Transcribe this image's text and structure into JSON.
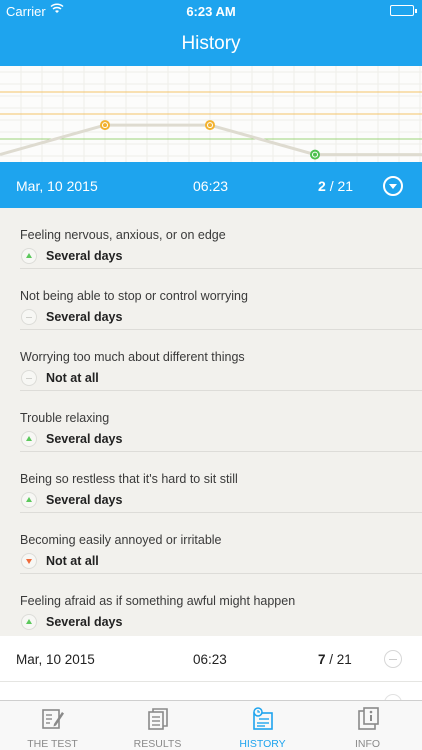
{
  "status_bar": {
    "carrier": "Carrier",
    "time": "6:23 AM"
  },
  "nav": {
    "title": "History"
  },
  "chart_data": {
    "type": "line",
    "x": [
      0,
      1,
      2,
      3,
      4
    ],
    "series": [
      {
        "values": [
          0,
          2,
          2,
          0,
          0
        ]
      }
    ],
    "threshold_lines": [
      {
        "color": "#f4c36a"
      },
      {
        "color": "#f4c36a"
      },
      {
        "color": "#9bd47a"
      }
    ],
    "ylim": [
      -0.5,
      6
    ],
    "grid": true
  },
  "selected_entry": {
    "date": "Mar, 10 2015",
    "time": "06:23",
    "score": "2",
    "max": "/ 21"
  },
  "questions": [
    {
      "text": "Feeling nervous, anxious, or on edge",
      "answer": "Several days",
      "trend": "up"
    },
    {
      "text": "Not being able to stop or control worrying",
      "answer": "Several days",
      "trend": "same"
    },
    {
      "text": "Worrying too much about different things",
      "answer": "Not at all",
      "trend": "same"
    },
    {
      "text": "Trouble relaxing",
      "answer": "Several days",
      "trend": "up"
    },
    {
      "text": "Being so restless that it's hard to sit still",
      "answer": "Several days",
      "trend": "up"
    },
    {
      "text": "Becoming easily annoyed or irritable",
      "answer": "Not at all",
      "trend": "down"
    },
    {
      "text": "Feeling afraid as if something awful might happen",
      "answer": "Several days",
      "trend": "up"
    }
  ],
  "history_entries": [
    {
      "date": "Mar, 10 2015",
      "time": "06:23",
      "score": "7",
      "max": "/ 21"
    }
  ],
  "tabs": [
    {
      "label": "THE TEST",
      "icon": "edit-icon",
      "active": false
    },
    {
      "label": "RESULTS",
      "icon": "results-icon",
      "active": false
    },
    {
      "label": "HISTORY",
      "icon": "history-icon",
      "active": true
    },
    {
      "label": "INFO",
      "icon": "info-icon",
      "active": false
    }
  ],
  "colors": {
    "accent": "#1ea4ee",
    "up": "#5cc85c",
    "down": "#ef6a3a",
    "point_orange": "#f2b230",
    "point_green": "#4fc04f"
  }
}
